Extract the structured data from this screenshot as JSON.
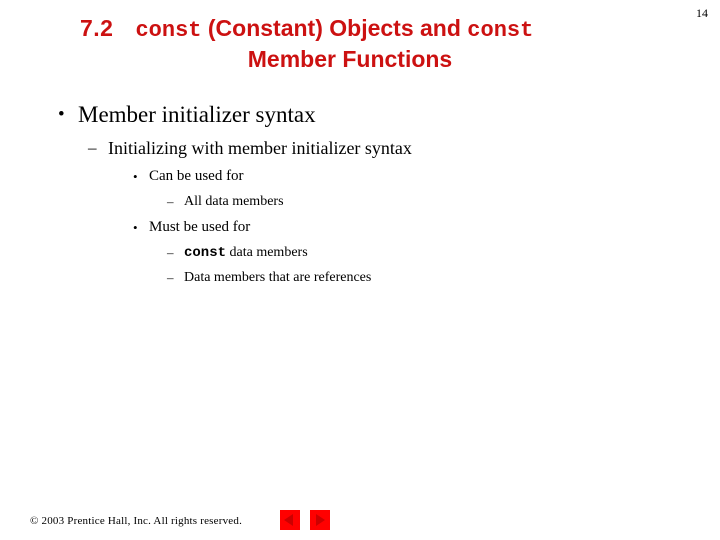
{
  "slide": {
    "page_number": "14",
    "background_color": "#FFFFFF",
    "accent_color": "#CC1111",
    "nav_button_color": "#FF0000"
  },
  "title": {
    "section_number": "7.2",
    "line1_mono_1": "const",
    "line1_text_1": " (Constant) Objects and ",
    "line1_mono_2": "const",
    "line2": "Member Functions"
  },
  "body": {
    "level1": {
      "marker": "•",
      "text": "Member initializer syntax"
    },
    "level2": {
      "marker": "–",
      "text": "Initializing with member initializer syntax"
    },
    "items": [
      {
        "marker": "•",
        "text": "Can be used for"
      },
      {
        "marker": "–",
        "text": "All data members"
      },
      {
        "marker": "•",
        "text": "Must be used for"
      },
      {
        "marker": "–",
        "mono": "const",
        "text": " data members"
      },
      {
        "marker": "–",
        "text": "Data members that are references"
      }
    ]
  },
  "footer": {
    "copyright": "© 2003 Prentice Hall, Inc.  All rights reserved.",
    "prev_icon": "left-triangle-icon",
    "next_icon": "right-triangle-icon"
  }
}
